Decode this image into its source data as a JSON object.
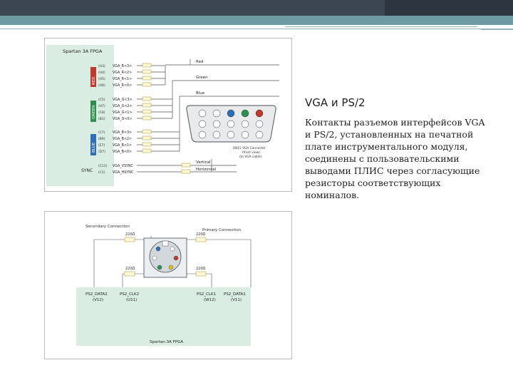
{
  "slide": {
    "title": "VGA и PS/2",
    "description": "Контакты разъемов интерфейсов VGA и PS/2, установленных на печатной плате инструментального модуля, соединены с пользовательскими выводами ПЛИС через согласующие резисторы соответствующих номиналов."
  },
  "vga_figure": {
    "fpga_label": "Spartan 3A FPGA",
    "groups": [
      "RED",
      "GREEN",
      "BLUE",
      "SYNC"
    ],
    "pins": [
      "(H3)",
      "(H4)",
      "(H5)",
      "(H6)",
      "(C5)",
      "(H7)",
      "(C8)",
      "(B1)",
      "(C7)",
      "(B9)",
      "(E7)",
      "(D7)",
      "(C11)",
      "(C1)"
    ],
    "signals": [
      "VGA_R<3>",
      "VGA_R<2>",
      "VGA_R<1>",
      "VGA_R<0>",
      "VGA_G<3>",
      "VGA_G<2>",
      "VGA_G<1>",
      "VGA_G<0>",
      "VGA_B<3>",
      "VGA_B<2>",
      "VGA_B<1>",
      "VGA_B<0>",
      "VGA_VSYNC",
      "VGA_HSYNC"
    ],
    "outputs": [
      "Red",
      "Green",
      "Blue"
    ],
    "sync_outputs": [
      "Vertical",
      "Horizontal"
    ],
    "connector_label": [
      "DB15 VGA Connector",
      "(front view)",
      "(to VGA cable)"
    ]
  },
  "ps2_figure": {
    "secondary_label": "Secondary Connection",
    "primary_label": "Primary Connection",
    "resistor_values": [
      "220Ω",
      "220Ω",
      "220Ω",
      "220Ω"
    ],
    "bottom_pins": [
      {
        "name": "PS2_DATA2",
        "pin": "(V12)"
      },
      {
        "name": "PS2_CLK2",
        "pin": "(U11)"
      },
      {
        "name": "PS2_CLK1",
        "pin": "(W12)"
      },
      {
        "name": "PS2_DATA1",
        "pin": "(V11)"
      }
    ],
    "fpga_label": "Spartan-3A FPGA"
  },
  "colors": {
    "topbar": "#3b4652",
    "accent": "#6e9aa3",
    "fpga_panel": "#d9ede2",
    "red_tag": "#c0392b",
    "green_tag": "#2f8f4e",
    "blue_tag": "#2f6fb8"
  }
}
